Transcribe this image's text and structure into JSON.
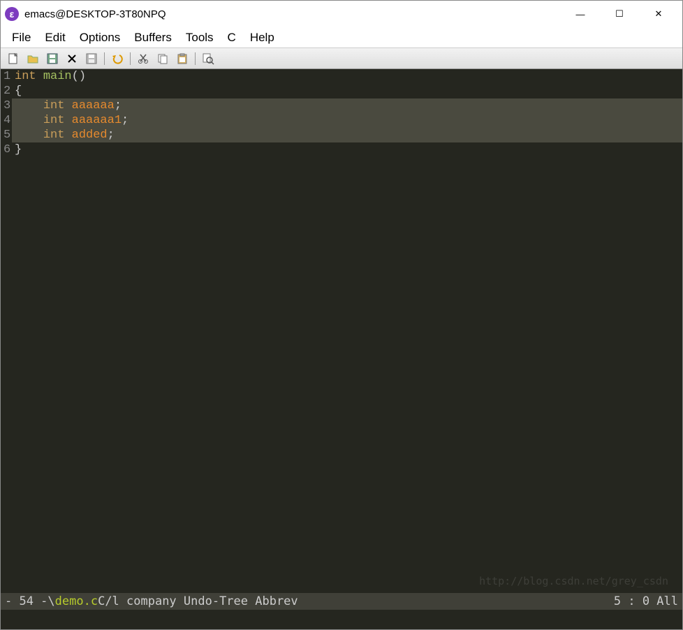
{
  "window": {
    "title": "emacs@DESKTOP-3T80NPQ",
    "icon_letter": "ε"
  },
  "win_buttons": {
    "min": "—",
    "max": "☐",
    "close": "✕"
  },
  "menu": [
    "File",
    "Edit",
    "Options",
    "Buffers",
    "Tools",
    "C",
    "Help"
  ],
  "toolbar": {
    "items": [
      "new-file-icon",
      "open-folder-icon",
      "disk-icon",
      "close-x-icon",
      "save-icon",
      "sep",
      "undo-icon",
      "sep",
      "cut-icon",
      "copy-icon",
      "paste-icon",
      "sep",
      "search-icon"
    ]
  },
  "code": {
    "lines": [
      {
        "n": "1",
        "hl": false,
        "tokens": [
          [
            "int",
            "k-type"
          ],
          [
            " ",
            "k-txt"
          ],
          [
            "main",
            "k-fn"
          ],
          [
            "()",
            "k-br"
          ]
        ]
      },
      {
        "n": "2",
        "hl": false,
        "tokens": [
          [
            "{",
            "k-br"
          ]
        ]
      },
      {
        "n": "3",
        "hl": true,
        "tokens": [
          [
            "    ",
            "k-txt"
          ],
          [
            "int",
            "k-type"
          ],
          [
            " ",
            "k-txt"
          ],
          [
            "aaaaaa",
            "k-var"
          ],
          [
            ";",
            "k-txt"
          ]
        ]
      },
      {
        "n": "4",
        "hl": true,
        "tokens": [
          [
            "    ",
            "k-txt"
          ],
          [
            "int",
            "k-type"
          ],
          [
            " ",
            "k-txt"
          ],
          [
            "aaaaaa1",
            "k-var"
          ],
          [
            ";",
            "k-txt"
          ]
        ]
      },
      {
        "n": "5",
        "hl": true,
        "tokens": [
          [
            "    ",
            "k-txt"
          ],
          [
            "int",
            "k-type"
          ],
          [
            " ",
            "k-txt"
          ],
          [
            "added",
            "k-var"
          ],
          [
            ";",
            "k-txt"
          ]
        ]
      },
      {
        "n": "6",
        "hl": false,
        "tokens": [
          [
            "}",
            "k-br"
          ]
        ]
      }
    ]
  },
  "modeline": {
    "left": "- 54 -\\  ",
    "filename": "demo.c",
    "middle": "       C/l company Undo-Tree Abbrev           ",
    "pos": "5 :  0  All"
  },
  "watermark": "http://blog.csdn.net/grey_csdn"
}
